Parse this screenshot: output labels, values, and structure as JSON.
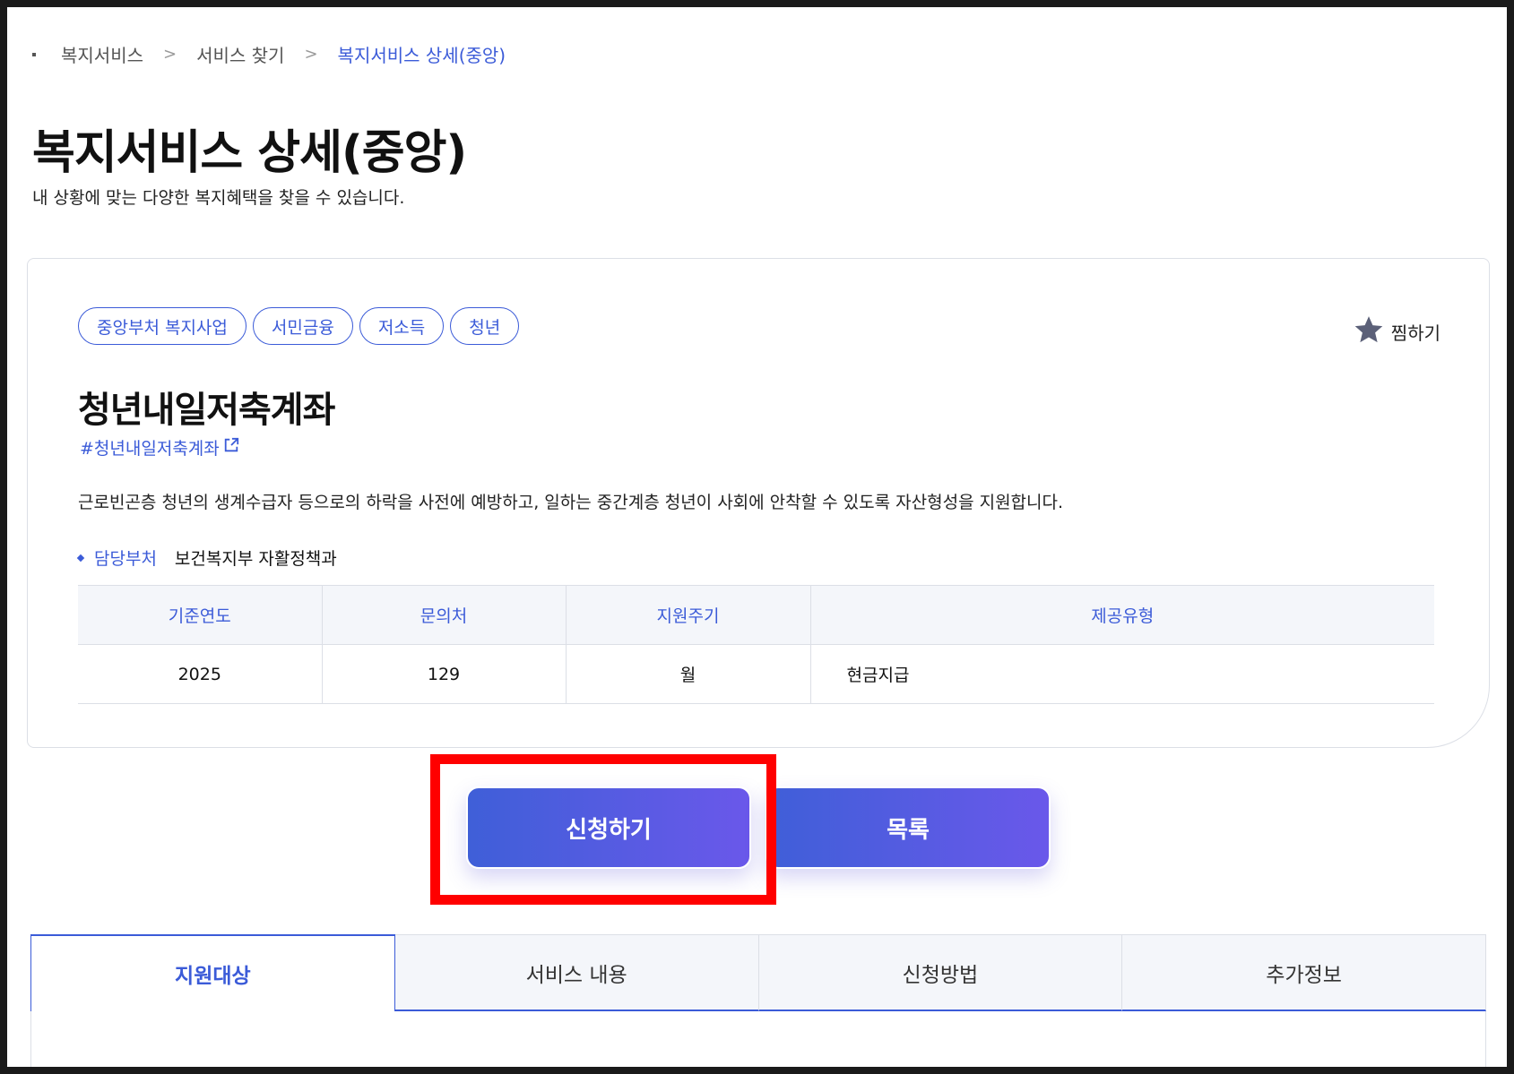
{
  "breadcrumb": {
    "items": [
      "복지서비스",
      "서비스 찾기",
      "복지서비스 상세(중앙)"
    ],
    "separator": ">"
  },
  "page": {
    "title": "복지서비스 상세(중앙)",
    "subtitle": "내 상황에 맞는 다양한 복지혜택을 찾을 수 있습니다."
  },
  "service": {
    "tags": [
      "중앙부처 복지사업",
      "서민금융",
      "저소득",
      "청년"
    ],
    "bookmark_label": "찜하기",
    "title": "청년내일저축계좌",
    "hashtag": "#청년내일저축계좌",
    "description": "근로빈곤층 청년의 생계수급자 등으로의 하락을 사전에 예방하고, 일하는 중간계층 청년이 사회에 안착할 수 있도록 자산형성을 지원합니다.",
    "dept_label": "담당부처",
    "dept_value": "보건복지부 자활정책과",
    "table": {
      "headers": [
        "기준연도",
        "문의처",
        "지원주기",
        "제공유형"
      ],
      "row": [
        "2025",
        "129",
        "월",
        "현금지급"
      ]
    }
  },
  "actions": {
    "apply_label": "신청하기",
    "list_label": "목록"
  },
  "tabs": [
    "지원대상",
    "서비스 내용",
    "신청방법",
    "추가정보"
  ],
  "colors": {
    "accent": "#3b5bd8",
    "button_gradient_start": "#3f5fd8",
    "button_gradient_end": "#6a58ea",
    "highlight": "#ff0000"
  },
  "icons": {
    "bookmark": "star-icon",
    "hashtag_link": "external-link-icon",
    "breadcrumb_separator": "chevron-right-icon"
  }
}
